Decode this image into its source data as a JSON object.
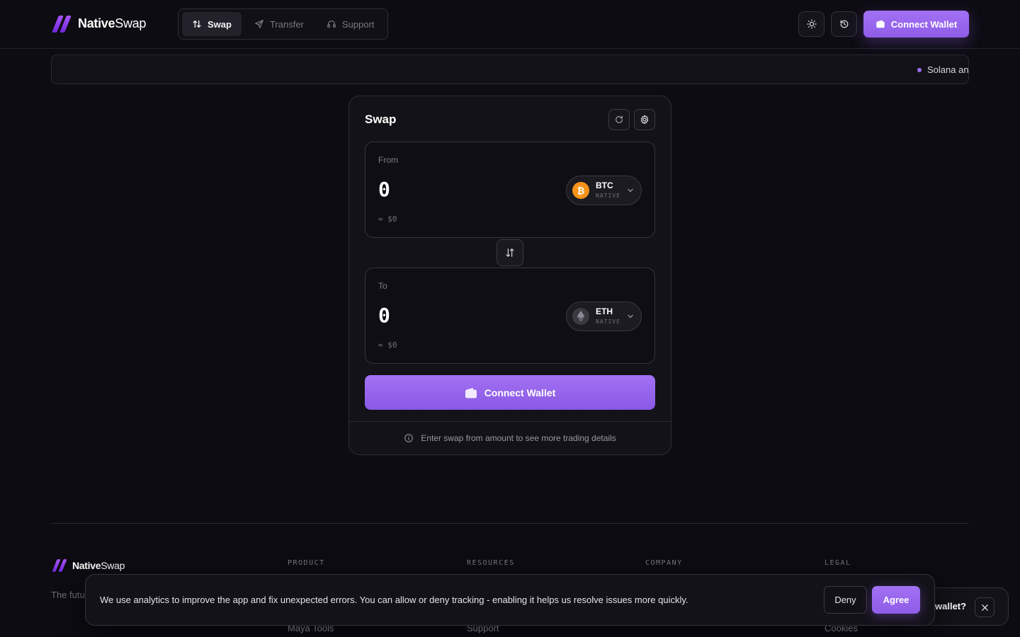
{
  "header": {
    "brand_bold": "Native",
    "brand_regular": "Swap",
    "nav": [
      {
        "label": "Swap",
        "active": true
      },
      {
        "label": "Transfer",
        "active": false
      },
      {
        "label": "Support",
        "active": false
      }
    ],
    "connect_label": "Connect Wallet"
  },
  "ticker": {
    "text": "Solana an"
  },
  "swap": {
    "title": "Swap",
    "from": {
      "label": "From",
      "amount": "0",
      "usd": "≈ $0",
      "token": "BTC",
      "network": "NATIVE"
    },
    "to": {
      "label": "To",
      "amount": "0",
      "usd": "≈ $0",
      "token": "ETH",
      "network": "NATIVE"
    },
    "connect_label": "Connect Wallet",
    "info": "Enter swap from amount to see more trading details"
  },
  "footer": {
    "brand_bold": "Native",
    "brand_regular": "Swap",
    "tagline": "The futu",
    "columns": [
      "PRODUCT",
      "RESOURCES",
      "COMPANY",
      "LEGAL"
    ],
    "links": [
      "Maya Tools",
      "Support",
      "Cookies"
    ]
  },
  "cookie": {
    "text": "We use analytics to improve the app and fix unexpected errors. You can allow or deny tracking - enabling it helps us resolve issues more quickly.",
    "deny": "Deny",
    "agree": "Agree"
  },
  "help": {
    "text": "wallet?"
  },
  "colors": {
    "accent": "#9b6cf0",
    "background": "#0d0c12",
    "btc": "#f7931a"
  }
}
